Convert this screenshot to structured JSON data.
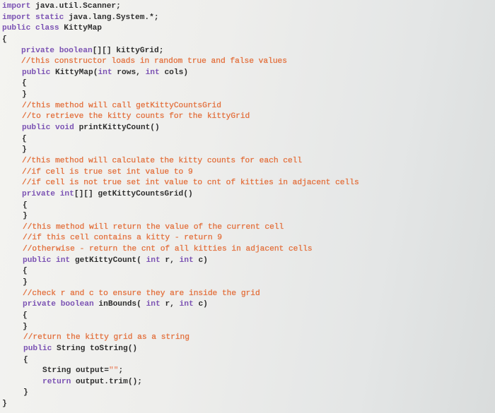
{
  "colors": {
    "keyword": "#7b52b3",
    "comment": "#e3713e",
    "plain": "#2e2e2e",
    "string": "#e88a6a"
  },
  "code_lines": [
    {
      "indent": 0,
      "tokens": [
        [
          "kw",
          "import"
        ],
        [
          "pl",
          " java.util.Scanner;"
        ]
      ]
    },
    {
      "indent": 0,
      "tokens": [
        [
          "kw",
          "import static"
        ],
        [
          "pl",
          " java.lang.System.*;"
        ]
      ]
    },
    {
      "indent": 0,
      "tokens": [
        [
          "kw",
          "public class"
        ],
        [
          "pl",
          " KittyMap"
        ]
      ]
    },
    {
      "indent": 0,
      "tokens": [
        [
          "pl",
          "{"
        ]
      ]
    },
    {
      "indent": 1,
      "tokens": [
        [
          "kw",
          "private boolean"
        ],
        [
          "pl",
          "[][] kittyGrid;"
        ]
      ]
    },
    {
      "indent": 1,
      "tokens": [
        [
          "cm",
          "//this constructor loads in random true and false values"
        ]
      ]
    },
    {
      "indent": 1,
      "tokens": [
        [
          "kw",
          "public"
        ],
        [
          "pl",
          " KittyMap("
        ],
        [
          "kw",
          "int"
        ],
        [
          "pl",
          " rows, "
        ],
        [
          "kw",
          "int"
        ],
        [
          "pl",
          " cols)"
        ]
      ]
    },
    {
      "indent": 1,
      "tokens": [
        [
          "pl",
          "{"
        ]
      ]
    },
    {
      "indent": 1,
      "tokens": [
        [
          "pl",
          "}"
        ]
      ]
    },
    {
      "indent": 1,
      "tokens": [
        [
          "cm",
          "//this method will call getKittyCountsGrid"
        ]
      ]
    },
    {
      "indent": 1,
      "tokens": [
        [
          "cm",
          "//to retrieve the kitty counts for the kittyGrid"
        ]
      ]
    },
    {
      "indent": 1,
      "tokens": [
        [
          "kw",
          "public void"
        ],
        [
          "pl",
          " printKittyCount()"
        ]
      ]
    },
    {
      "indent": 1,
      "tokens": [
        [
          "pl",
          "{"
        ]
      ]
    },
    {
      "indent": 1,
      "tokens": [
        [
          "pl",
          "}"
        ]
      ]
    },
    {
      "indent": 1,
      "tokens": [
        [
          "cm",
          "//this method will calculate the kitty counts for each cell"
        ]
      ]
    },
    {
      "indent": 1,
      "tokens": [
        [
          "cm",
          "//if cell is true set int value to 9"
        ]
      ]
    },
    {
      "indent": 1,
      "tokens": [
        [
          "cm",
          "//if cell is not true set int value to cnt of kitties in adjacent cells"
        ]
      ]
    },
    {
      "indent": 1,
      "tokens": [
        [
          "kw",
          "private int"
        ],
        [
          "pl",
          "[][] getKittyCountsGrid()"
        ]
      ]
    },
    {
      "indent": 1,
      "tokens": [
        [
          "pl",
          "{"
        ]
      ]
    },
    {
      "indent": 1,
      "tokens": [
        [
          "pl",
          "}"
        ]
      ]
    },
    {
      "indent": 1,
      "tokens": [
        [
          "cm",
          "//this method will return the value of the current cell"
        ]
      ]
    },
    {
      "indent": 1,
      "tokens": [
        [
          "cm",
          "//if this cell contains a kitty - return 9"
        ]
      ]
    },
    {
      "indent": 1,
      "tokens": [
        [
          "cm",
          "//otherwise - return the cnt of all kitties in adjacent cells"
        ]
      ]
    },
    {
      "indent": 1,
      "tokens": [
        [
          "kw",
          "public int"
        ],
        [
          "pl",
          " getKittyCount( "
        ],
        [
          "kw",
          "int"
        ],
        [
          "pl",
          " r, "
        ],
        [
          "kw",
          "int"
        ],
        [
          "pl",
          " c)"
        ]
      ]
    },
    {
      "indent": 1,
      "tokens": [
        [
          "pl",
          "{"
        ]
      ]
    },
    {
      "indent": 1,
      "tokens": [
        [
          "pl",
          "}"
        ]
      ]
    },
    {
      "indent": 1,
      "tokens": [
        [
          "cm",
          "//check r and c to ensure they are inside the grid"
        ]
      ]
    },
    {
      "indent": 1,
      "tokens": [
        [
          "kw",
          "private boolean"
        ],
        [
          "pl",
          " inBounds( "
        ],
        [
          "kw",
          "int"
        ],
        [
          "pl",
          " r, "
        ],
        [
          "kw",
          "int"
        ],
        [
          "pl",
          " c)"
        ]
      ]
    },
    {
      "indent": 1,
      "tokens": [
        [
          "pl",
          "{"
        ]
      ]
    },
    {
      "indent": 1,
      "tokens": [
        [
          "pl",
          "}"
        ]
      ]
    },
    {
      "indent": 1,
      "tokens": [
        [
          "cm",
          "//return the kitty grid as a string"
        ]
      ]
    },
    {
      "indent": 1,
      "tokens": [
        [
          "kw",
          "public"
        ],
        [
          "pl",
          " String toString()"
        ]
      ]
    },
    {
      "indent": 1,
      "tokens": [
        [
          "pl",
          "{"
        ]
      ]
    },
    {
      "indent": 2,
      "tokens": [
        [
          "pl",
          "String output="
        ],
        [
          "st",
          "\"\""
        ],
        [
          "pl",
          ";"
        ]
      ]
    },
    {
      "indent": 2,
      "tokens": [
        [
          "kw",
          "return"
        ],
        [
          "pl",
          " output.trim();"
        ]
      ]
    },
    {
      "indent": 1,
      "tokens": [
        [
          "pl",
          "}"
        ]
      ]
    },
    {
      "indent": 0,
      "tokens": [
        [
          "pl",
          "}"
        ]
      ]
    }
  ]
}
